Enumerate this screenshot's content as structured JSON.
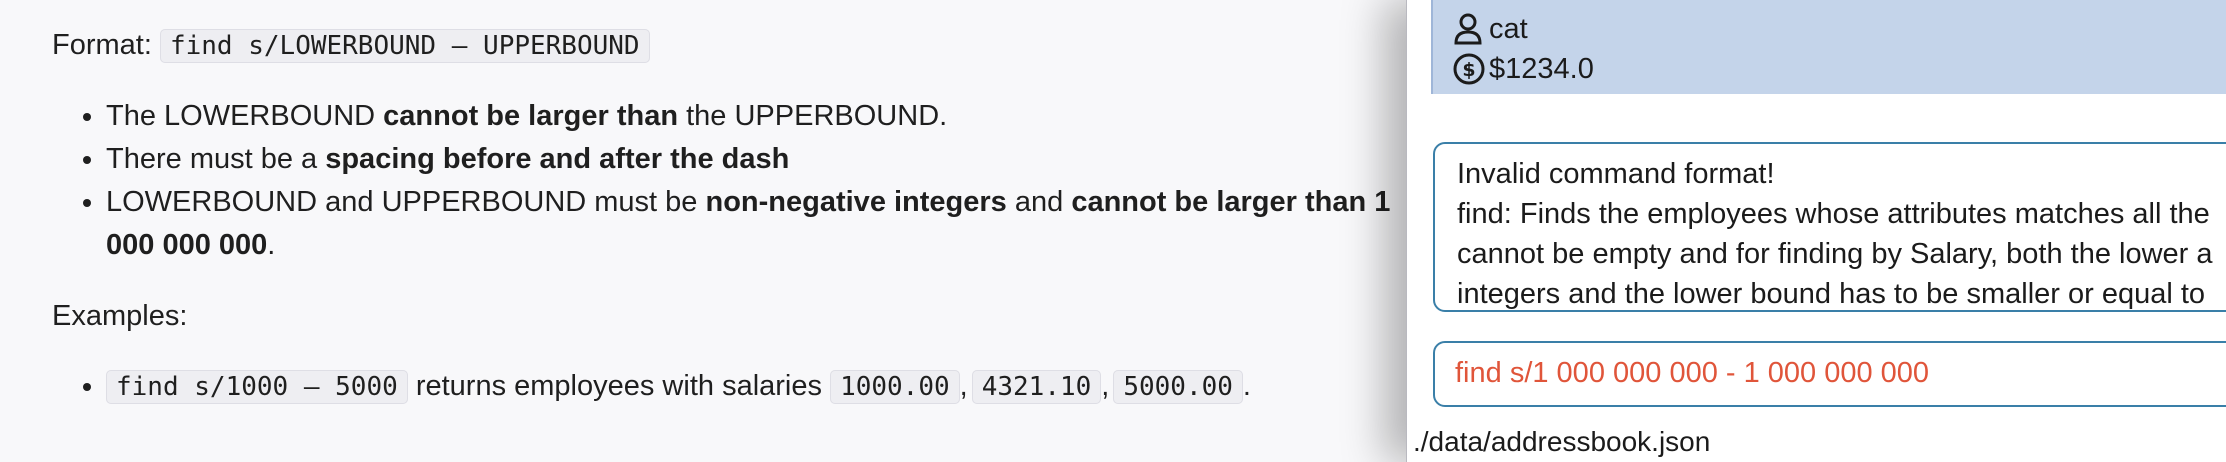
{
  "doc": {
    "format_label": "Format:",
    "format_code": "find s/LOWERBOUND – UPPERBOUND",
    "bullets": {
      "b1": {
        "pre": "The LOWERBOUND ",
        "bold": "cannot be larger than",
        "post": " the UPPERBOUND."
      },
      "b2": {
        "pre": "There must be a ",
        "bold": "spacing before and after the dash"
      },
      "b3": {
        "pre": "LOWERBOUND and UPPERBOUND must be ",
        "bold1": "non-negative integers",
        "mid": " and ",
        "bold2": "cannot be larger than 1",
        "bold3": "000 000 000",
        "post": "."
      }
    },
    "examples_label": "Examples:",
    "example": {
      "code": "find s/1000 – 5000",
      "text": " returns employees with salaries ",
      "values": [
        "1000.00",
        "4321.10",
        "5000.00"
      ],
      "sep": ",",
      "end": "."
    }
  },
  "app": {
    "card": {
      "name": "cat",
      "salary": "$1234.0"
    },
    "result": {
      "line1": "Invalid command format!",
      "line2": "find: Finds the employees whose attributes matches all the",
      "line3": "cannot be empty and for finding by Salary, both the lower a",
      "line4": "integers and the lower bound has to be smaller or equal to"
    },
    "command_value": "find s/1 000 000 000 - 1 000 000 000",
    "status_path": "./data/addressbook.json",
    "colors": {
      "card_bg": "#c4d4ea",
      "box_border": "#3a7fa8",
      "error_text": "#e0553a"
    },
    "icons": [
      "department-icon",
      "person-icon",
      "dollar-icon"
    ]
  }
}
